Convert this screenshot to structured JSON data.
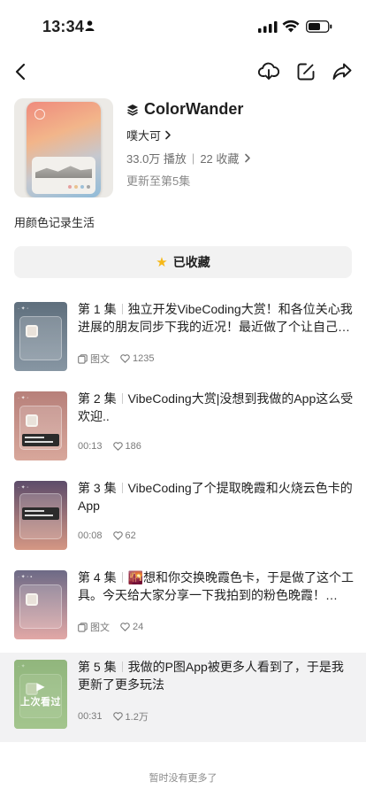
{
  "status_bar": {
    "time": "13:34"
  },
  "header": {
    "title": "ColorWander",
    "author": "噗大可",
    "plays": "33.0万 播放",
    "collections": "22 收藏",
    "update": "更新至第5集",
    "description": "用颜色记录生活",
    "collected_label": "已收藏"
  },
  "episodes": [
    {
      "num": "第 1 集",
      "title": "独立开发VibeCoding大赏！和各位关心我进展的朋友同步下我的近况！最近做了个让自己…",
      "type_label": "图文",
      "stat": "1235",
      "thumb_from": "#5f6f7d",
      "thumb_to": "#8796a3"
    },
    {
      "num": "第 2 集",
      "title": "VibeCoding大赏|没想到我做的App这么受欢迎..",
      "type_label": "00:13",
      "stat": "186",
      "thumb_from": "#b7807a",
      "thumb_to": "#d8a79b"
    },
    {
      "num": "第 3 集",
      "title": "VibeCoding了个提取晚霞和火烧云色卡的App",
      "type_label": "00:08",
      "stat": "62",
      "thumb_from": "#5d4c6a",
      "thumb_to": "#d59784"
    },
    {
      "num": "第 4 集",
      "title": "🌇想和你交换晚霞色卡，于是做了这个工具。今天给大家分享一下我拍到的粉色晚霞！…",
      "type_label": "图文",
      "stat": "24",
      "thumb_from": "#6d6a86",
      "thumb_to": "#e2a8a6"
    },
    {
      "num": "第 5 集",
      "title": "我做的P图App被更多人看到了，于是我更新了更多玩法",
      "type_label": "00:31",
      "stat": "1.2万",
      "thumb_from": "#7fa46b",
      "thumb_to": "#a6c58e",
      "overlay_label": "上次看过"
    }
  ],
  "footer": {
    "text": "暂时没有更多了"
  },
  "colors": {
    "star": "#f6b817",
    "active_row": "#f2f2f3"
  }
}
